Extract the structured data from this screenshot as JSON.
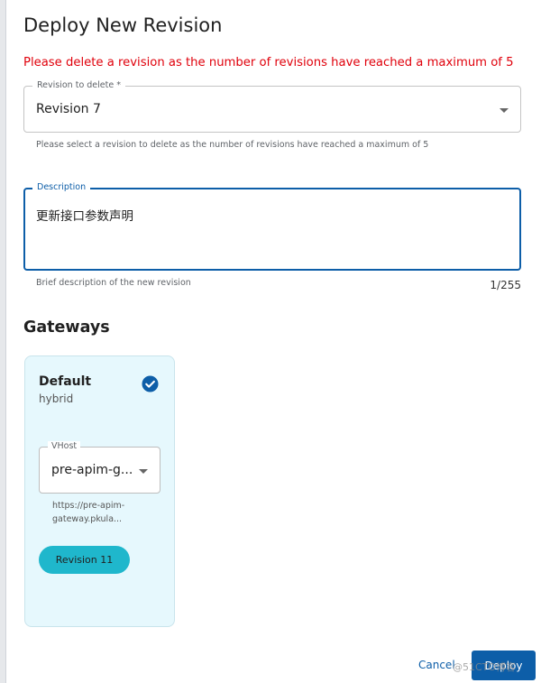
{
  "dialog": {
    "title": "Deploy New Revision",
    "error_message": "Please delete a revision as the number of revisions have reached a maximum of 5"
  },
  "revision_to_delete": {
    "label": "Revision to delete *",
    "value": "Revision 7",
    "helper": "Please select a revision to delete as the number of revisions have reached a maximum of 5"
  },
  "description": {
    "label": "Description",
    "value": "更新接口参数声明",
    "helper": "Brief description of the new revision",
    "counter": "1/255"
  },
  "gateways": {
    "title": "Gateways",
    "cards": [
      {
        "name": "Default",
        "type": "hybrid",
        "selected": true,
        "vhost_label": "VHost",
        "vhost_value": "pre-apim-gateway.pkula...",
        "vhost_display": "pre-apim-g...",
        "url_line1": "https://pre-apim-",
        "url_line2": "gateway.pkula...",
        "revision": "Revision 11"
      }
    ]
  },
  "actions": {
    "cancel_label": "Cancel",
    "deploy_label": "Deploy"
  },
  "watermark": "@51CTO博客",
  "colors": {
    "primary": "#0d5ea8",
    "error": "#e0000b",
    "card_bg": "#e6f8fd",
    "chip": "#1fb7cc"
  }
}
